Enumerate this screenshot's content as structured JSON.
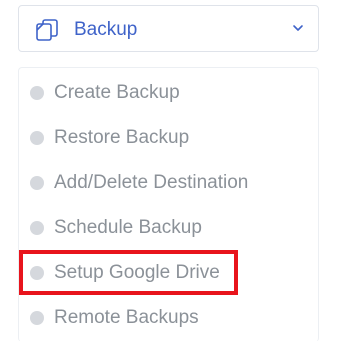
{
  "header": {
    "label": "Backup",
    "icon": "copy-icon",
    "chevron_icon": "chevron-down-icon",
    "accent_color": "#3f63c9"
  },
  "menu": {
    "items": [
      {
        "label": "Create Backup"
      },
      {
        "label": "Restore Backup"
      },
      {
        "label": "Add/Delete Destination"
      },
      {
        "label": "Schedule Backup"
      },
      {
        "label": "Setup Google Drive"
      },
      {
        "label": "Remote Backups"
      }
    ],
    "highlighted_item": "Setup Google Drive",
    "highlight_color": "#e8141c"
  }
}
